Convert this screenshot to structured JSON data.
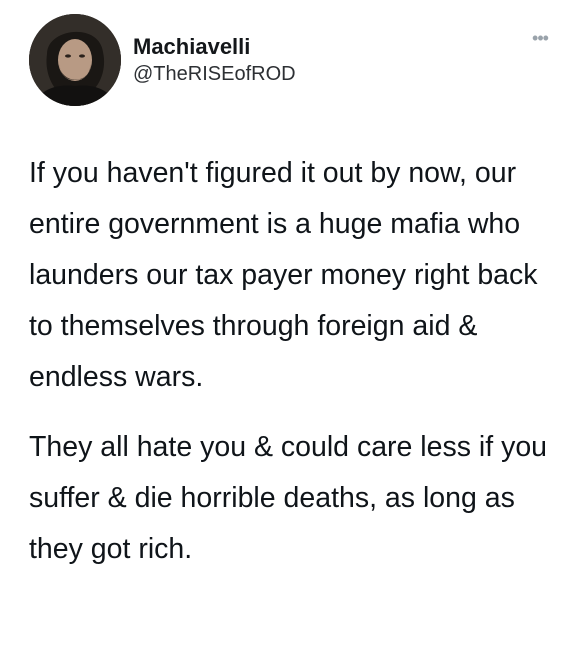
{
  "tweet": {
    "author": {
      "display_name": "Machiavelli",
      "handle": "@TheRISEofROD",
      "avatar_icon": "profile-photo"
    },
    "more_icon": "more-horizontal-icon",
    "paragraphs": [
      "If you haven't figured it out by now, our entire government is a huge mafia who launders our tax payer money right back to themselves through foreign aid & endless wars.",
      "They all hate you & could care less if you suffer & die horrible deaths, as long as they got rich."
    ]
  }
}
